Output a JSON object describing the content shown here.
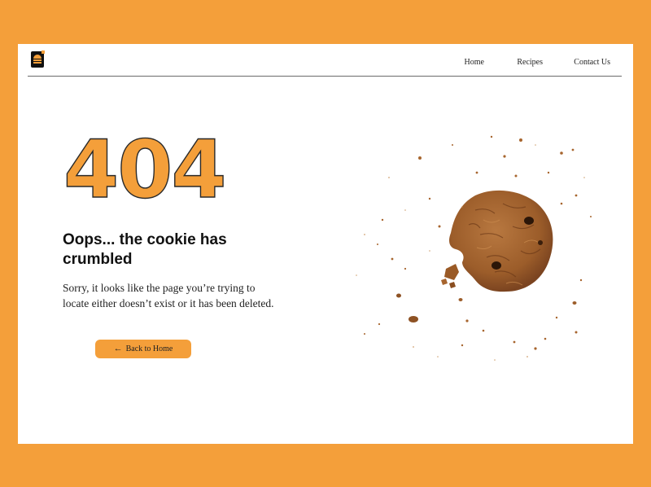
{
  "header": {
    "nav": [
      {
        "label": "Home"
      },
      {
        "label": "Recipes"
      },
      {
        "label": "Contact Us"
      }
    ]
  },
  "error": {
    "code": "404",
    "headline": "Oops... the cookie has crumbled",
    "message": "Sorry, it looks like the page you’re trying to locate either doesn’t exist or it has been deleted."
  },
  "back_button": {
    "label": "Back to Home",
    "icon": "arrow-left-icon"
  },
  "colors": {
    "accent": "#f49f3a",
    "text": "#111111",
    "cookie": "#a8662f"
  }
}
